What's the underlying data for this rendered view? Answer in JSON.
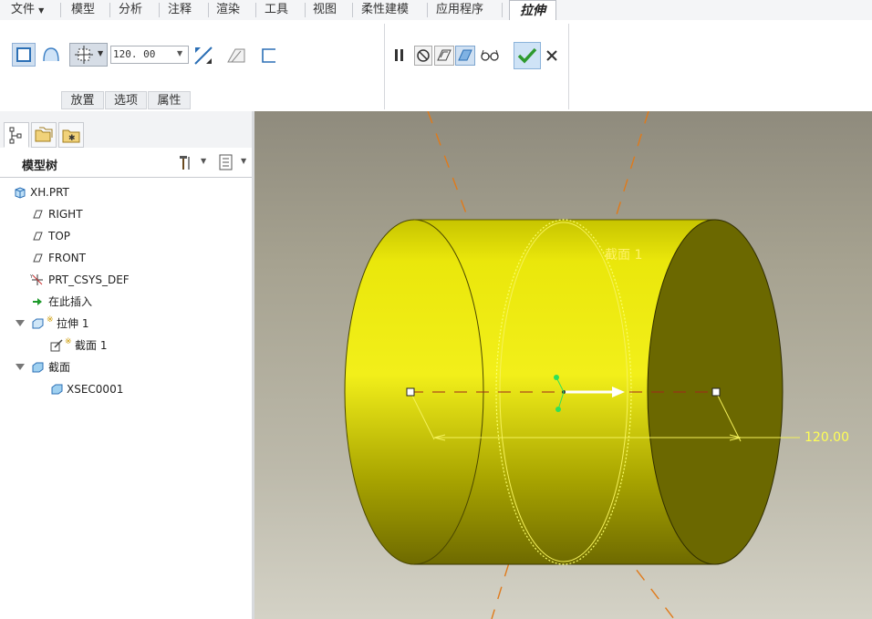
{
  "menubar": {
    "file": "文件",
    "items": [
      "模型",
      "分析",
      "注释",
      "渲染",
      "工具",
      "视图",
      "柔性建模",
      "应用程序"
    ],
    "active_tab": "拉伸"
  },
  "ribbon": {
    "depth_value": "120. 00",
    "subtabs": [
      "放置",
      "选项",
      "属性"
    ]
  },
  "model_tree": {
    "title": "模型树",
    "items": [
      {
        "label": "XH.PRT"
      },
      {
        "label": "RIGHT"
      },
      {
        "label": "TOP"
      },
      {
        "label": "FRONT"
      },
      {
        "label": "PRT_CSYS_DEF"
      },
      {
        "label": "在此插入"
      },
      {
        "label": "拉伸 1"
      },
      {
        "label": "截面 1"
      },
      {
        "label": "截面"
      },
      {
        "label": "XSEC0001"
      }
    ]
  },
  "viewport": {
    "dimension_label": "120.00",
    "section_label": "截面 1"
  },
  "colors": {
    "part_yellow": "#e8e60a",
    "accent_green": "#3aa63a",
    "viewport_bg": "#aaa693"
  }
}
